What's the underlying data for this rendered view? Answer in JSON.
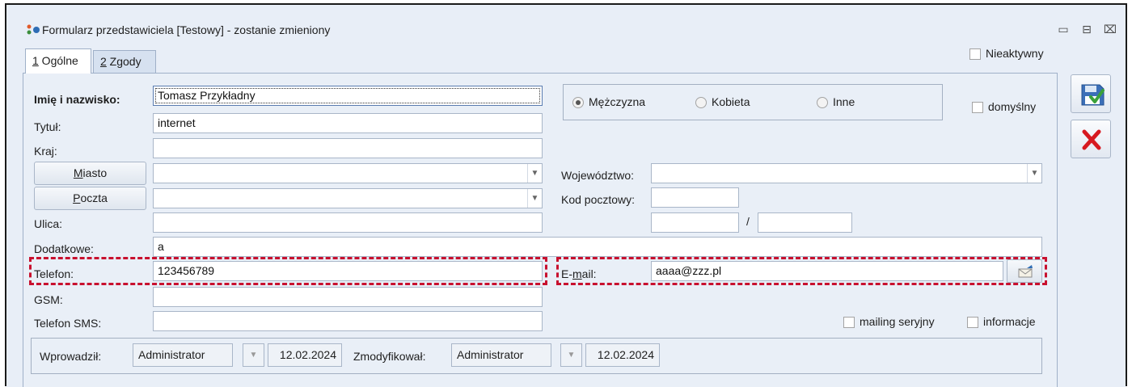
{
  "window": {
    "title": "Formularz przedstawiciela [Testowy] - zostanie zmieniony",
    "minimize_glyph": "▭",
    "restore_glyph": "⊟",
    "close_glyph": "⌧"
  },
  "tabs": [
    {
      "hotkey": "1",
      "rest": " Ogólne"
    },
    {
      "hotkey": "2",
      "rest": " Zgody"
    }
  ],
  "nieaktywny_label": "Nieaktywny",
  "form": {
    "imie_label": "Imię i nazwisko:",
    "imie_value": "Tomasz Przykładny",
    "tytul_label": "Tytuł:",
    "tytul_value": "internet",
    "kraj_label": "Kraj:",
    "kraj_value": "",
    "miasto_button": {
      "hotkey": "M",
      "rest": "iasto"
    },
    "miasto_value": "",
    "poczta_button": {
      "hotkey": "P",
      "rest": "oczta"
    },
    "poczta_value": "",
    "ulica_label": "Ulica:",
    "ulica_value": "",
    "dodatkowe_label": "Dodatkowe:",
    "dodatkowe_value": "a",
    "telefon_label": "Telefon:",
    "telefon_value": "123456789",
    "gsm_label": "GSM:",
    "gsm_value": "",
    "telefon_sms_label": "Telefon SMS:",
    "telefon_sms_value": "",
    "wojewodztwo_label": "Województwo:",
    "wojewodztwo_value": "",
    "kod_pocztowy_label": "Kod pocztowy:",
    "kod_pocztowy_value": "",
    "nr_domu_value": "",
    "nr_lokalu_value": "",
    "slash": "/",
    "email_label_pre": "E-",
    "email_label_hotkey": "m",
    "email_label_post": "ail:",
    "email_value": "aaaa@zzz.pl"
  },
  "gender": {
    "options": [
      "Mężczyzna",
      "Kobieta",
      "Inne"
    ],
    "selected": "Mężczyzna"
  },
  "checkboxes": {
    "domyslny": "domyślny",
    "mailing": "mailing seryjny",
    "informacje": "informacje"
  },
  "audit": {
    "wprowadzil_label": "Wprowadził:",
    "wprowadzil_user": "Administrator",
    "wprowadzil_date": "12.02.2024",
    "zmodyfikowal_label": "Zmodyfikował:",
    "zmodyfikowal_user": "Administrator",
    "zmodyfikowal_date": "12.02.2024"
  },
  "icons": {
    "save": "save-icon",
    "cancel": "cancel-icon",
    "email_send": "email-send-icon",
    "app": "app-icon"
  },
  "colors": {
    "highlight": "#c8102e",
    "window_bg": "#e8eef7",
    "save_check": "#3aa13a",
    "cancel_x": "#d71920"
  }
}
